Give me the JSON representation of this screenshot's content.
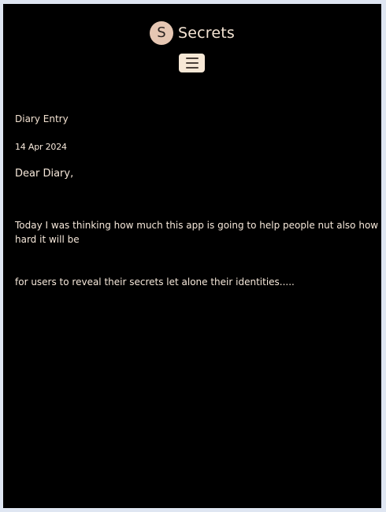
{
  "header": {
    "logo_letter": "S",
    "brand_name": "Secrets",
    "menu_icon": "hamburger-icon"
  },
  "entry": {
    "section_title": "Diary Entry",
    "date": "14 Apr 2024",
    "greeting": "Dear Diary,",
    "body_line_1": "Today I was thinking how much this app is going to help people nut also how hard it will be",
    "body_line_2": "for users to reveal their secrets let alone their identities....."
  },
  "colors": {
    "page_background": "#000000",
    "outer_background": "#dfe6f2",
    "logo_fill": "#e6c7b3",
    "menu_button_fill": "#f7e8d6",
    "text": "#f6e8da"
  }
}
